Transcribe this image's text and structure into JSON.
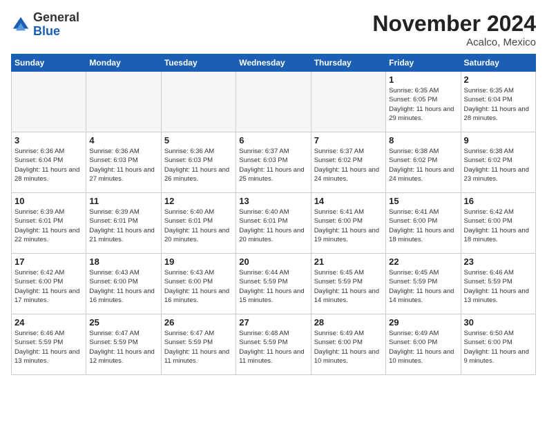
{
  "logo": {
    "general": "General",
    "blue": "Blue"
  },
  "title": "November 2024",
  "location": "Acalco, Mexico",
  "days_of_week": [
    "Sunday",
    "Monday",
    "Tuesday",
    "Wednesday",
    "Thursday",
    "Friday",
    "Saturday"
  ],
  "weeks": [
    [
      {
        "day": "",
        "info": ""
      },
      {
        "day": "",
        "info": ""
      },
      {
        "day": "",
        "info": ""
      },
      {
        "day": "",
        "info": ""
      },
      {
        "day": "",
        "info": ""
      },
      {
        "day": "1",
        "info": "Sunrise: 6:35 AM\nSunset: 6:05 PM\nDaylight: 11 hours and 29 minutes."
      },
      {
        "day": "2",
        "info": "Sunrise: 6:35 AM\nSunset: 6:04 PM\nDaylight: 11 hours and 28 minutes."
      }
    ],
    [
      {
        "day": "3",
        "info": "Sunrise: 6:36 AM\nSunset: 6:04 PM\nDaylight: 11 hours and 28 minutes."
      },
      {
        "day": "4",
        "info": "Sunrise: 6:36 AM\nSunset: 6:03 PM\nDaylight: 11 hours and 27 minutes."
      },
      {
        "day": "5",
        "info": "Sunrise: 6:36 AM\nSunset: 6:03 PM\nDaylight: 11 hours and 26 minutes."
      },
      {
        "day": "6",
        "info": "Sunrise: 6:37 AM\nSunset: 6:03 PM\nDaylight: 11 hours and 25 minutes."
      },
      {
        "day": "7",
        "info": "Sunrise: 6:37 AM\nSunset: 6:02 PM\nDaylight: 11 hours and 24 minutes."
      },
      {
        "day": "8",
        "info": "Sunrise: 6:38 AM\nSunset: 6:02 PM\nDaylight: 11 hours and 24 minutes."
      },
      {
        "day": "9",
        "info": "Sunrise: 6:38 AM\nSunset: 6:02 PM\nDaylight: 11 hours and 23 minutes."
      }
    ],
    [
      {
        "day": "10",
        "info": "Sunrise: 6:39 AM\nSunset: 6:01 PM\nDaylight: 11 hours and 22 minutes."
      },
      {
        "day": "11",
        "info": "Sunrise: 6:39 AM\nSunset: 6:01 PM\nDaylight: 11 hours and 21 minutes."
      },
      {
        "day": "12",
        "info": "Sunrise: 6:40 AM\nSunset: 6:01 PM\nDaylight: 11 hours and 20 minutes."
      },
      {
        "day": "13",
        "info": "Sunrise: 6:40 AM\nSunset: 6:01 PM\nDaylight: 11 hours and 20 minutes."
      },
      {
        "day": "14",
        "info": "Sunrise: 6:41 AM\nSunset: 6:00 PM\nDaylight: 11 hours and 19 minutes."
      },
      {
        "day": "15",
        "info": "Sunrise: 6:41 AM\nSunset: 6:00 PM\nDaylight: 11 hours and 18 minutes."
      },
      {
        "day": "16",
        "info": "Sunrise: 6:42 AM\nSunset: 6:00 PM\nDaylight: 11 hours and 18 minutes."
      }
    ],
    [
      {
        "day": "17",
        "info": "Sunrise: 6:42 AM\nSunset: 6:00 PM\nDaylight: 11 hours and 17 minutes."
      },
      {
        "day": "18",
        "info": "Sunrise: 6:43 AM\nSunset: 6:00 PM\nDaylight: 11 hours and 16 minutes."
      },
      {
        "day": "19",
        "info": "Sunrise: 6:43 AM\nSunset: 6:00 PM\nDaylight: 11 hours and 16 minutes."
      },
      {
        "day": "20",
        "info": "Sunrise: 6:44 AM\nSunset: 5:59 PM\nDaylight: 11 hours and 15 minutes."
      },
      {
        "day": "21",
        "info": "Sunrise: 6:45 AM\nSunset: 5:59 PM\nDaylight: 11 hours and 14 minutes."
      },
      {
        "day": "22",
        "info": "Sunrise: 6:45 AM\nSunset: 5:59 PM\nDaylight: 11 hours and 14 minutes."
      },
      {
        "day": "23",
        "info": "Sunrise: 6:46 AM\nSunset: 5:59 PM\nDaylight: 11 hours and 13 minutes."
      }
    ],
    [
      {
        "day": "24",
        "info": "Sunrise: 6:46 AM\nSunset: 5:59 PM\nDaylight: 11 hours and 13 minutes."
      },
      {
        "day": "25",
        "info": "Sunrise: 6:47 AM\nSunset: 5:59 PM\nDaylight: 11 hours and 12 minutes."
      },
      {
        "day": "26",
        "info": "Sunrise: 6:47 AM\nSunset: 5:59 PM\nDaylight: 11 hours and 11 minutes."
      },
      {
        "day": "27",
        "info": "Sunrise: 6:48 AM\nSunset: 5:59 PM\nDaylight: 11 hours and 11 minutes."
      },
      {
        "day": "28",
        "info": "Sunrise: 6:49 AM\nSunset: 6:00 PM\nDaylight: 11 hours and 10 minutes."
      },
      {
        "day": "29",
        "info": "Sunrise: 6:49 AM\nSunset: 6:00 PM\nDaylight: 11 hours and 10 minutes."
      },
      {
        "day": "30",
        "info": "Sunrise: 6:50 AM\nSunset: 6:00 PM\nDaylight: 11 hours and 9 minutes."
      }
    ]
  ]
}
